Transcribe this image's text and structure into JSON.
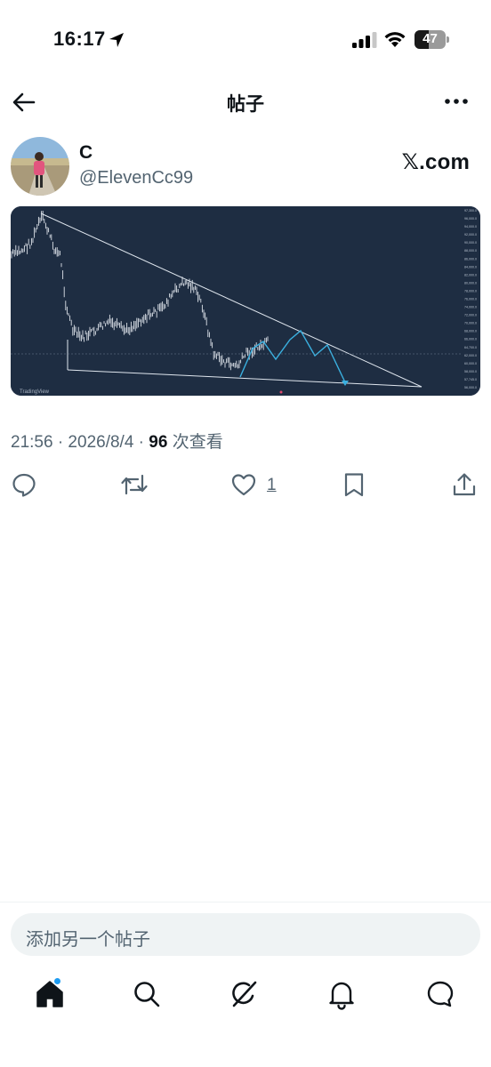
{
  "status_bar": {
    "time": "16:17",
    "battery": "47"
  },
  "nav": {
    "title": "帖子"
  },
  "post": {
    "display_name": "C",
    "handle": "@ElevenCc99",
    "source": "𝕏.com",
    "time": "21:56 · 2026/8/4 · ",
    "views": "96",
    "views_label": " 次查看",
    "like_count": "1"
  },
  "chart_data": {
    "type": "line",
    "watermark": "TradingView",
    "y_labels": [
      "97,300.0",
      "96,000.0",
      "94,000.0",
      "92,000.0",
      "90,000.0",
      "88,000.0",
      "86,000.0",
      "84,000.0",
      "82,000.0",
      "80,000.0",
      "78,000.0",
      "76,000.0",
      "74,000.0",
      "72,000.0",
      "70,000.0",
      "68,000.0",
      "66,000.0",
      "64,700.0",
      "62,000.0",
      "60,000.0",
      "58,000.0",
      "57,745.0",
      "56,000.0"
    ],
    "projection_color": "#3ab0e0",
    "background": "#1e2d42"
  },
  "reply": {
    "placeholder": "添加另一个帖子"
  },
  "colors": {
    "accent": "#1d9bf0",
    "text": "#0f1419",
    "muted": "#536471"
  }
}
